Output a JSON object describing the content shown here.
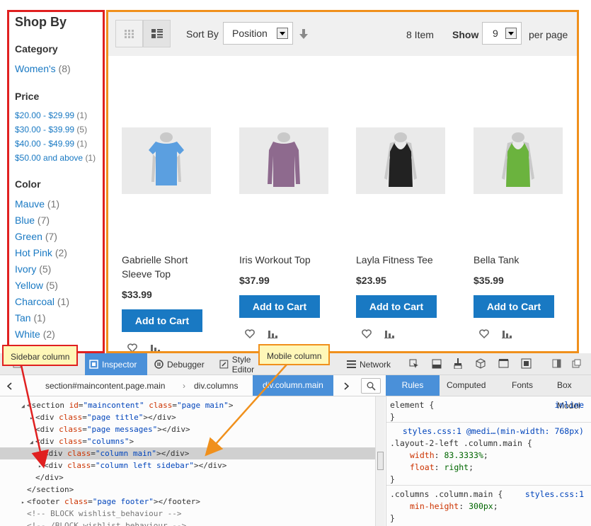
{
  "sidebar": {
    "title": "Shop By",
    "category": {
      "heading": "Category",
      "items": [
        {
          "label": "Women's",
          "count": "(8)"
        }
      ]
    },
    "price": {
      "heading": "Price",
      "items": [
        {
          "label": "$20.00 - $29.99",
          "count": "(1)"
        },
        {
          "label": "$30.00 - $39.99",
          "count": "(5)"
        },
        {
          "label": "$40.00 - $49.99",
          "count": "(1)"
        },
        {
          "label": "$50.00 and above",
          "count": "(1)"
        }
      ]
    },
    "color": {
      "heading": "Color",
      "items": [
        {
          "label": "Mauve",
          "count": "(1)"
        },
        {
          "label": "Blue",
          "count": "(7)"
        },
        {
          "label": "Green",
          "count": "(7)"
        },
        {
          "label": "Hot Pink",
          "count": "(2)"
        },
        {
          "label": "Ivory",
          "count": "(5)"
        },
        {
          "label": "Yellow",
          "count": "(5)"
        },
        {
          "label": "Charcoal",
          "count": "(1)"
        },
        {
          "label": "Tan",
          "count": "(1)"
        },
        {
          "label": "White",
          "count": "(2)"
        }
      ]
    }
  },
  "toolbar": {
    "grid_icon": "grid-icon",
    "list_icon": "list-icon",
    "sort_label": "Sort By",
    "sort_value": "Position",
    "sort_dir_icon": "arrow-down-icon",
    "item_count": "8 Item",
    "show_label": "Show",
    "show_value": "9",
    "per_page_label": "per page"
  },
  "products": [
    {
      "name": "Gabrielle Short Sleeve Top",
      "price": "$33.99",
      "cart_label": "Add to Cart",
      "color": "#5b9fe0",
      "garment": "tee"
    },
    {
      "name": "Iris Workout Top",
      "price": "$37.99",
      "cart_label": "Add to Cart",
      "color": "#8e6a8e",
      "garment": "longsleeve"
    },
    {
      "name": "Layla Fitness Tee",
      "price": "$23.95",
      "cart_label": "Add to Cart",
      "color": "#222222",
      "garment": "tank"
    },
    {
      "name": "Bella Tank",
      "price": "$35.99",
      "cart_label": "Add to Cart",
      "color": "#6bb33e",
      "garment": "tank"
    }
  ],
  "callouts": {
    "sidebar": "Sidebar column",
    "mobile": "Mobile column"
  },
  "devtools": {
    "tabs": {
      "inspector": "Inspector",
      "debugger": "Debugger",
      "style_editor": "Style Editor",
      "network": "Network"
    },
    "breadcrumbs": [
      "section#maincontent.page.main",
      "div.columns",
      "div.column.main"
    ],
    "rule_tabs": [
      "Rules",
      "Computed",
      "Fonts",
      "Box Model"
    ],
    "markup": [
      {
        "tag_open": "<section ",
        "attr": "id",
        "val": "\"maincontent\"",
        "attr2": "class",
        "val2": "\"page main\"",
        "close": ">"
      },
      {
        "tag_open": "<div ",
        "attr": "class",
        "val": "\"page title\"",
        "close": "></div>"
      },
      {
        "tag_open": "<div ",
        "attr": "class",
        "val": "\"page messages\"",
        "close": "></div>"
      },
      {
        "tag_open": "<div ",
        "attr": "class",
        "val": "\"columns\"",
        "close": ">"
      },
      {
        "tag_open": "<div ",
        "attr": "class",
        "val": "\"column main\"",
        "close": "></div>"
      },
      {
        "tag_open": "<div ",
        "attr": "class",
        "val": "\"column left sidebar\"",
        "close": "></div>"
      },
      {
        "tag_open": "</div>",
        "close": ""
      },
      {
        "tag_open": "</section>",
        "close": ""
      },
      {
        "tag_open": "<footer ",
        "attr": "class",
        "val": "\"page footer\"",
        "close": "></footer>"
      },
      {
        "comment": "<!-- BLOCK wishlist_behaviour -->"
      },
      {
        "comment": "<!-- /BLOCK wishlist_behaviour -->"
      }
    ],
    "rules": {
      "element_selector": "element {",
      "element_close": "}",
      "element_src": "inline",
      "rule1_src": "styles.css:1 @medi…(min-width: 768px)",
      "rule1_selector": ".layout-2-left .column.main {",
      "rule1_prop1": "width",
      "rule1_val1": "83.3333%",
      "rule1_prop2": "float",
      "rule1_val2": "right",
      "rule1_close": "}",
      "rule2_selector": ".columns .column.main {",
      "rule2_src": "styles.css:1",
      "rule2_prop1": "min-height",
      "rule2_val1": "300px",
      "rule2_close": "}"
    }
  }
}
